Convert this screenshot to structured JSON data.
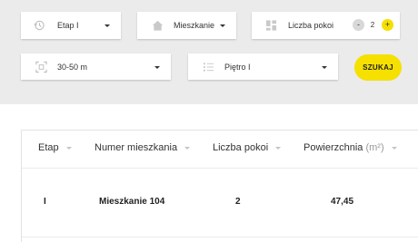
{
  "filters": {
    "etap": {
      "label": "Etap I",
      "icon": "history-icon"
    },
    "type": {
      "label": "Mieszkanie",
      "icon": "house-icon"
    },
    "rooms": {
      "label": "Liczba pokoi",
      "icon": "grid-icon",
      "minus": "-",
      "value": "2",
      "plus": "+"
    },
    "area": {
      "label": "30-50 m",
      "icon": "area-frame-icon"
    },
    "floor": {
      "label": "Piętro I",
      "icon": "list-icon"
    },
    "search_label": "SZUKAJ"
  },
  "table": {
    "columns": [
      {
        "label": "Etap"
      },
      {
        "label": "Numer mieszkania"
      },
      {
        "label": "Liczba pokoi"
      },
      {
        "label": "Powierzchnia",
        "unit": "(m²)"
      }
    ],
    "rows": [
      {
        "etap": "I",
        "numer": "Mieszkanie 104",
        "pokoje": "2",
        "powierzchnia": "47,45"
      }
    ]
  },
  "colors": {
    "accent": "#f5e000",
    "panel": "#ebebeb"
  }
}
